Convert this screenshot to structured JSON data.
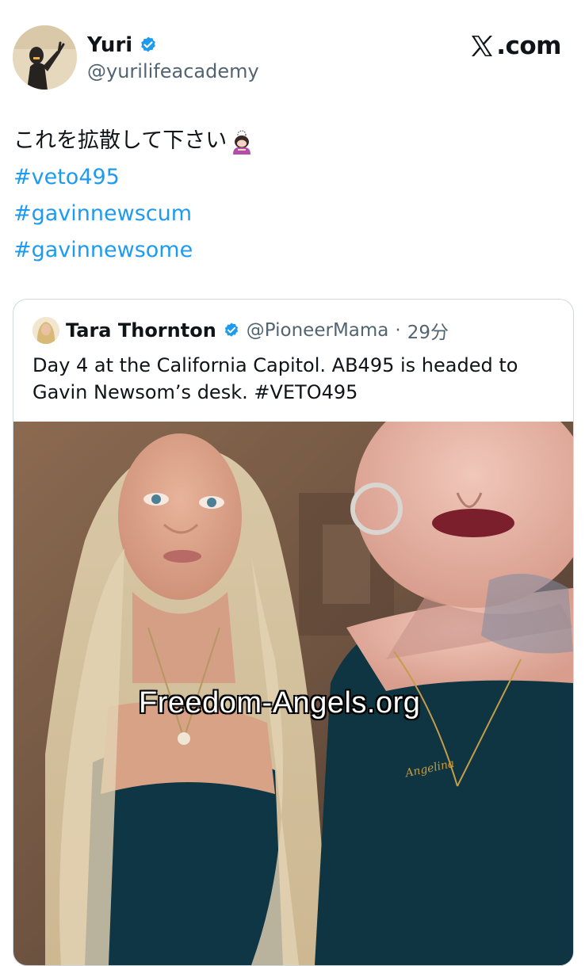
{
  "author": {
    "display_name": "Yuri",
    "handle": "@yurilifeacademy",
    "verified": true,
    "avatar_icon": "person-peace-sign-avatar"
  },
  "source_brand": {
    "text": ".com",
    "logo_icon": "x-logo-icon"
  },
  "tweet": {
    "text": "これを拡散して下さい",
    "emoji_icon": "person-bowing-emoji-icon",
    "hashtags": [
      "#veto495",
      "#gavinnewscum",
      "#gavinnewsome"
    ]
  },
  "quoted_tweet": {
    "display_name": "Tara Thornton",
    "handle": "@PioneerMama",
    "separator": "·",
    "time": "29分",
    "verified": true,
    "text_lines": [
      "Day 4 at the California Capitol. AB495 is headed to",
      "Gavin Newsom’s desk. #VETO495"
    ],
    "media": {
      "watermark": "Freedom-Angels.org",
      "necklace_text": "Angelina"
    }
  },
  "colors": {
    "accent_link": "#1d9bf0",
    "verified_blue": "#1d9bf0",
    "text_primary": "#0f1419",
    "text_secondary": "#536471",
    "card_border": "#cfd9de"
  }
}
